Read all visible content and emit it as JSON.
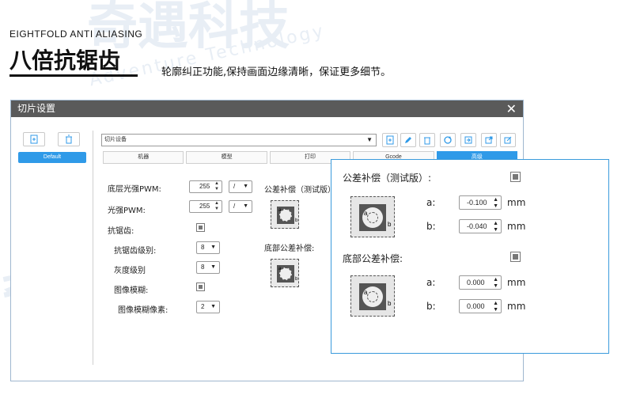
{
  "header": {
    "subtitle_en": "EIGHTFOLD ANTI ALIASING",
    "title": "八倍抗锯齿",
    "description": "轮廓纠正功能,保持画面边缘清晰，保证更多细节。"
  },
  "watermark": {
    "brand_cn": "奇遇科技",
    "brand_en": "Adventure Technology"
  },
  "dialog": {
    "title": "切片设置",
    "close_icon": "close-icon",
    "left_panel": {
      "default_item": "Default"
    },
    "profile_select": "切片设备",
    "tabs": [
      {
        "label": "机器"
      },
      {
        "label": "模型"
      },
      {
        "label": "打印"
      },
      {
        "label": "Gcode"
      },
      {
        "label": "高级"
      }
    ],
    "settings": {
      "bottom_pwm_label": "底层光强PWM:",
      "bottom_pwm_value": "255",
      "bottom_pwm_unit": "/",
      "pwm_label": "光强PWM:",
      "pwm_value": "255",
      "pwm_unit": "/",
      "aa_label": "抗锯齿:",
      "aa_level_label": "抗锯齿级别:",
      "aa_level_value": "8",
      "gray_level_label": "灰度级别",
      "gray_level_value": "8",
      "blur_label": "图像模糊:",
      "blur_px_label": "图像模糊像素:",
      "blur_px_value": "2",
      "tolerance_label": "公差补偿（测试版）:",
      "bottom_tolerance_label": "底部公差补偿:"
    }
  },
  "zoom": {
    "tolerance_label": "公差补偿（测试版）:",
    "a_label": "a:",
    "a_value": "-0.100",
    "a_unit": "mm",
    "b_label": "b:",
    "b_value": "-0.040",
    "b_unit": "mm",
    "bottom_label": "底部公差补偿:",
    "bottom_a_label": "a:",
    "bottom_a_value": "0.000",
    "bottom_a_unit": "mm",
    "bottom_b_label": "b:",
    "bottom_b_value": "0.000",
    "bottom_b_unit": "mm"
  },
  "colors": {
    "accent": "#2f9ae8",
    "titlebar": "#5a5a5a",
    "zoom_border": "#3a9bdc"
  }
}
